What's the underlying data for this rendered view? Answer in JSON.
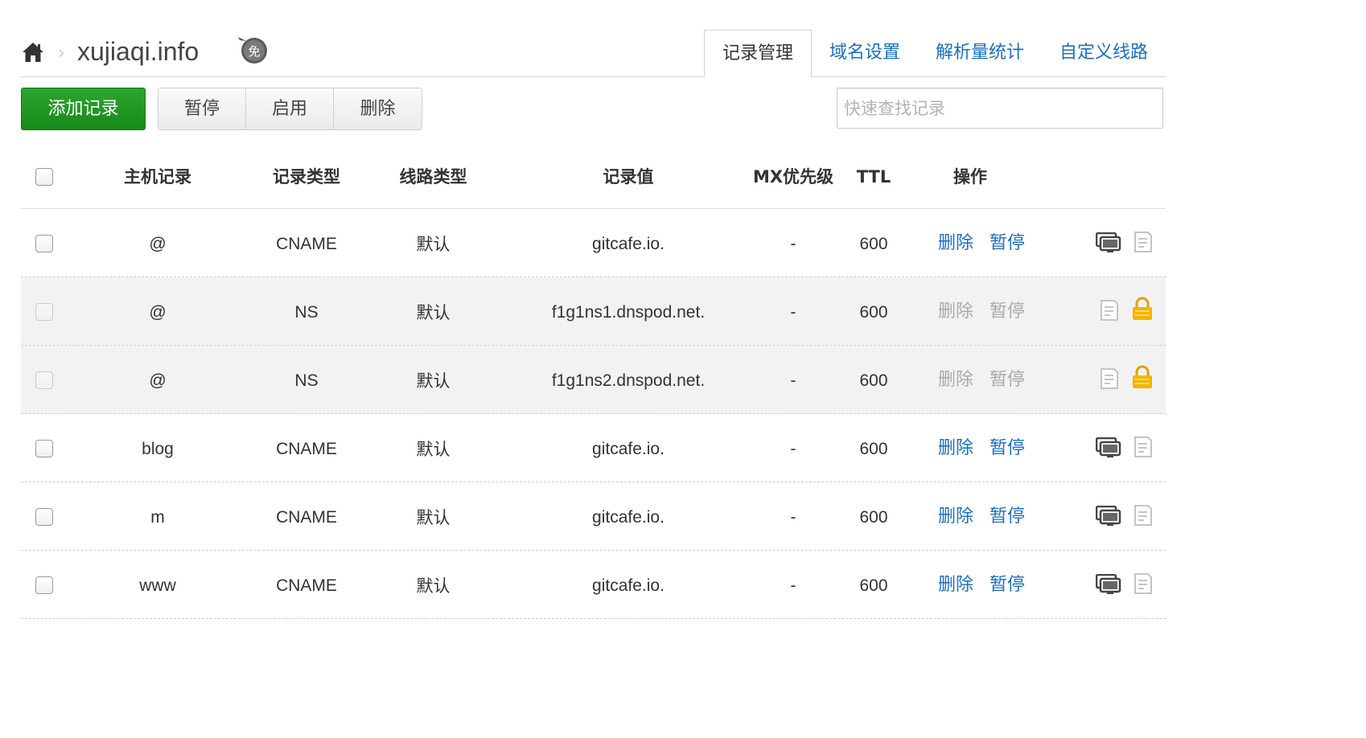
{
  "header": {
    "domain": "xujiaqi.info",
    "separator": "›",
    "badge_label": "免",
    "tabs": [
      {
        "label": "记录管理",
        "active": true
      },
      {
        "label": "域名设置",
        "active": false
      },
      {
        "label": "解析量统计",
        "active": false
      },
      {
        "label": "自定义线路",
        "active": false
      }
    ]
  },
  "toolbar": {
    "add_label": "添加记录",
    "pause_label": "暂停",
    "enable_label": "启用",
    "delete_label": "删除",
    "search_placeholder": "快速查找记录"
  },
  "table": {
    "columns": [
      "主机记录",
      "记录类型",
      "线路类型",
      "记录值",
      "MX优先级",
      "TTL",
      "操作"
    ],
    "rows": [
      {
        "host": "@",
        "type": "CNAME",
        "line": "默认",
        "value": "gitcafe.io.",
        "mx": "-",
        "ttl": "600",
        "delete": "删除",
        "pause": "暂停",
        "locked": false
      },
      {
        "host": "@",
        "type": "NS",
        "line": "默认",
        "value": "f1g1ns1.dnspod.net.",
        "mx": "-",
        "ttl": "600",
        "delete": "删除",
        "pause": "暂停",
        "locked": true
      },
      {
        "host": "@",
        "type": "NS",
        "line": "默认",
        "value": "f1g1ns2.dnspod.net.",
        "mx": "-",
        "ttl": "600",
        "delete": "删除",
        "pause": "暂停",
        "locked": true
      },
      {
        "host": "blog",
        "type": "CNAME",
        "line": "默认",
        "value": "gitcafe.io.",
        "mx": "-",
        "ttl": "600",
        "delete": "删除",
        "pause": "暂停",
        "locked": false
      },
      {
        "host": "m",
        "type": "CNAME",
        "line": "默认",
        "value": "gitcafe.io.",
        "mx": "-",
        "ttl": "600",
        "delete": "删除",
        "pause": "暂停",
        "locked": false
      },
      {
        "host": "www",
        "type": "CNAME",
        "line": "默认",
        "value": "gitcafe.io.",
        "mx": "-",
        "ttl": "600",
        "delete": "删除",
        "pause": "暂停",
        "locked": false
      }
    ]
  },
  "colors": {
    "primary_green": "#1e9a21",
    "link_blue": "#1a6fc4",
    "disabled_gray": "#aaaaaa",
    "locked_row_bg": "#f2f2f2",
    "lock_yellow": "#f5b400"
  },
  "icons": {
    "home": "home-icon",
    "badge": "free-badge-icon",
    "monitor": "monitor-icon",
    "note": "remark-icon",
    "lock": "lock-icon"
  }
}
